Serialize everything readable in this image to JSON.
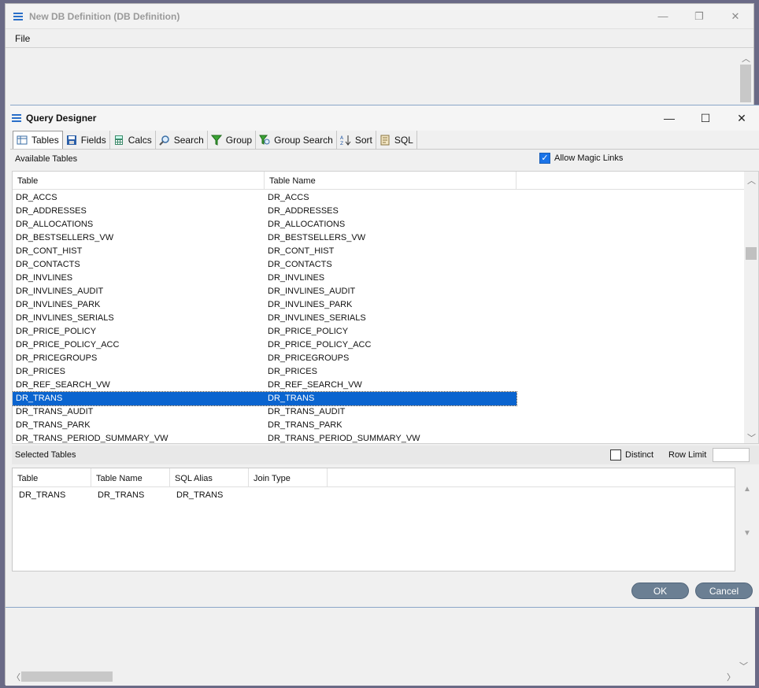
{
  "outer_window": {
    "title": "New DB Definition (DB Definition)",
    "menu": [
      "File"
    ],
    "controls": [
      "—",
      "❐",
      "✕"
    ]
  },
  "dialog": {
    "title": "Query Designer",
    "controls": [
      "—",
      "☐",
      "✕"
    ],
    "tabs": [
      {
        "label": "Tables",
        "icon": "table-icon"
      },
      {
        "label": "Fields",
        "icon": "save-icon"
      },
      {
        "label": "Calcs",
        "icon": "calculator-icon"
      },
      {
        "label": "Search",
        "icon": "magnifier-icon"
      },
      {
        "label": "Group",
        "icon": "funnel-icon"
      },
      {
        "label": "Group Search",
        "icon": "funnel-search-icon"
      },
      {
        "label": "Sort",
        "icon": "sort-az-icon"
      },
      {
        "label": "SQL",
        "icon": "sql-script-icon"
      }
    ],
    "available": {
      "label": "Available Tables",
      "allow_magic_links_label": "Allow Magic Links",
      "allow_magic_links_checked": true,
      "columns": [
        "Table",
        "Table Name"
      ],
      "rows": [
        [
          "DR_ACCS",
          "DR_ACCS"
        ],
        [
          "DR_ADDRESSES",
          "DR_ADDRESSES"
        ],
        [
          "DR_ALLOCATIONS",
          "DR_ALLOCATIONS"
        ],
        [
          "DR_BESTSELLERS_VW",
          "DR_BESTSELLERS_VW"
        ],
        [
          "DR_CONT_HIST",
          "DR_CONT_HIST"
        ],
        [
          "DR_CONTACTS",
          "DR_CONTACTS"
        ],
        [
          "DR_INVLINES",
          "DR_INVLINES"
        ],
        [
          "DR_INVLINES_AUDIT",
          "DR_INVLINES_AUDIT"
        ],
        [
          "DR_INVLINES_PARK",
          "DR_INVLINES_PARK"
        ],
        [
          "DR_INVLINES_SERIALS",
          "DR_INVLINES_SERIALS"
        ],
        [
          "DR_PRICE_POLICY",
          "DR_PRICE_POLICY"
        ],
        [
          "DR_PRICE_POLICY_ACC",
          "DR_PRICE_POLICY_ACC"
        ],
        [
          "DR_PRICEGROUPS",
          "DR_PRICEGROUPS"
        ],
        [
          "DR_PRICES",
          "DR_PRICES"
        ],
        [
          "DR_REF_SEARCH_VW",
          "DR_REF_SEARCH_VW"
        ],
        [
          "DR_TRANS",
          "DR_TRANS"
        ],
        [
          "DR_TRANS_AUDIT",
          "DR_TRANS_AUDIT"
        ],
        [
          "DR_TRANS_PARK",
          "DR_TRANS_PARK"
        ],
        [
          "DR_TRANS_PERIOD_SUMMARY_VW",
          "DR_TRANS_PERIOD_SUMMARY_VW"
        ]
      ],
      "selected_row": 15
    },
    "selected": {
      "label": "Selected Tables",
      "distinct_label": "Distinct",
      "distinct_checked": false,
      "row_limit_label": "Row Limit",
      "row_limit_value": "",
      "columns": [
        "Table",
        "Table Name",
        "SQL Alias",
        "Join Type"
      ],
      "rows": [
        [
          "DR_TRANS",
          "DR_TRANS",
          "DR_TRANS",
          ""
        ]
      ]
    },
    "buttons": {
      "ok": "OK",
      "cancel": "Cancel"
    }
  }
}
